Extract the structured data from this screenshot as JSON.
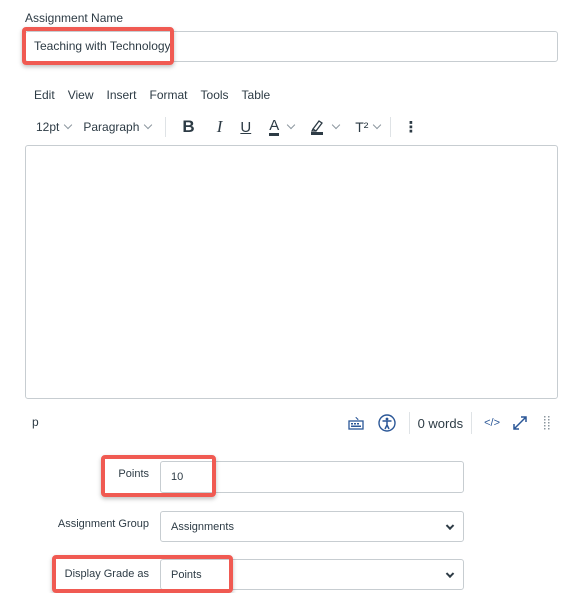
{
  "assignment_name": {
    "label": "Assignment Name",
    "value": "Teaching with Technology"
  },
  "editor": {
    "menu": [
      "Edit",
      "View",
      "Insert",
      "Format",
      "Tools",
      "Table"
    ],
    "toolbar": {
      "font_size": "12pt",
      "block_format": "Paragraph",
      "bold": "B",
      "italic": "I",
      "underline": "U",
      "text_color": "A",
      "superscript": "T²",
      "more": "⋮"
    },
    "content": "",
    "statusbar": {
      "element_path": "p",
      "word_count": "0 words",
      "html_toggle": "</>"
    }
  },
  "form": {
    "points": {
      "label": "Points",
      "value": "10"
    },
    "assignment_group": {
      "label": "Assignment Group",
      "value": "Assignments"
    },
    "display_grade": {
      "label": "Display Grade as",
      "value": "Points"
    }
  },
  "colors": {
    "highlight": "#f05a52",
    "text": "#2d3b45",
    "border": "#c7cdd1",
    "icon_accent": "#2b5797"
  }
}
